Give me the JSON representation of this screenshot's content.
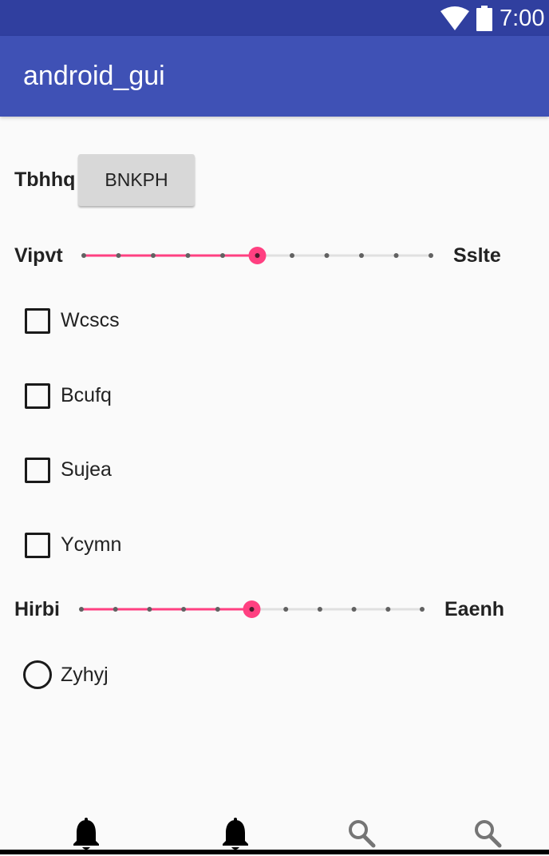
{
  "status_bar": {
    "time": "7:00",
    "icons": [
      "wifi-icon",
      "battery-icon"
    ]
  },
  "app_bar": {
    "title": "android_gui"
  },
  "row1": {
    "label": "Tbhhq",
    "button_label": "BNKPH"
  },
  "slider1": {
    "left_label": "Vipvt",
    "right_label": "Sslte",
    "value": 5,
    "max": 10
  },
  "checkboxes": [
    {
      "label": "Wcscs",
      "checked": false
    },
    {
      "label": "Bcufq",
      "checked": false
    },
    {
      "label": "Sujea",
      "checked": false
    },
    {
      "label": "Ycymn",
      "checked": false
    }
  ],
  "slider2": {
    "left_label": "Hirbi",
    "right_label": "Eaenh",
    "value": 5,
    "max": 10
  },
  "radio": {
    "label": "Zyhyj",
    "selected": false
  },
  "bottom_nav": [
    {
      "icon": "bell-icon"
    },
    {
      "icon": "bell-icon"
    },
    {
      "icon": "search-icon"
    },
    {
      "icon": "search-icon"
    }
  ],
  "colors": {
    "primary": "#3f51b5",
    "primary_dark": "#303f9f",
    "accent": "#ff4081",
    "background": "#fafafa"
  }
}
